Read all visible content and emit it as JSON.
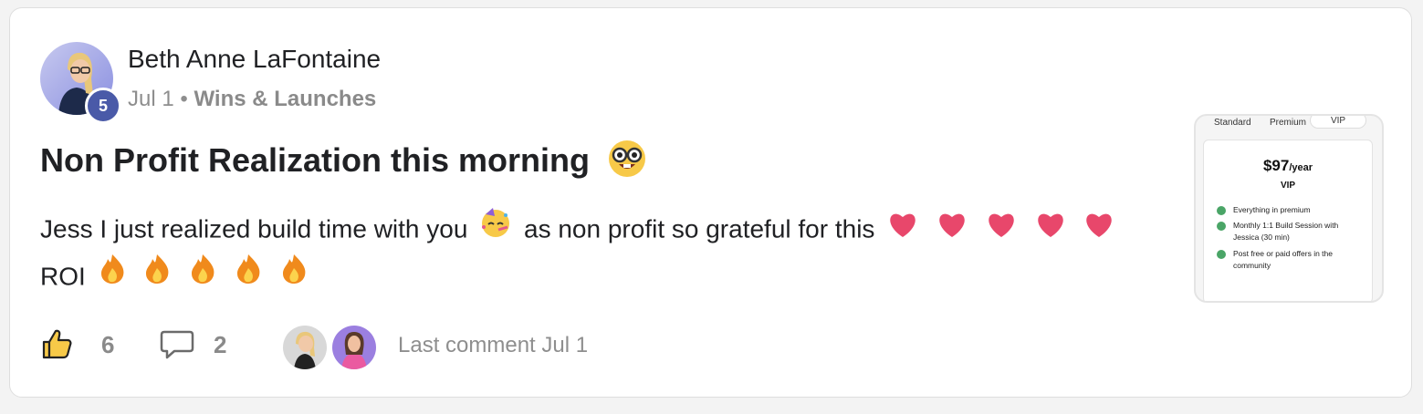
{
  "post": {
    "author": "Beth Anne LaFontaine",
    "level": "5",
    "date": "Jul 1",
    "separator": "•",
    "category": "Wins & Launches",
    "title": "Non Profit Realization this morning",
    "body_part1": "Jess I just realized build time with you",
    "body_part2": "as non profit so grateful for this",
    "body_part3": "ROI",
    "likes": "6",
    "comments": "2",
    "last_comment": "Last comment Jul 1"
  },
  "thumbnail": {
    "tabs": [
      "Standard",
      "Premium",
      "VIP"
    ],
    "price": "$97",
    "period": "/year",
    "plan": "VIP",
    "features": [
      "Everything in premium",
      "Monthly 1:1 Build Session with Jessica (30 min)",
      "Post free or paid offers in the community"
    ]
  },
  "icons": {
    "title_emoji": "nerd-face-icon",
    "body_emoji": "partying-face-icon",
    "hearts": "heart-icon",
    "fires": "fire-icon",
    "like": "thumbs-up-icon",
    "comment": "speech-bubble-icon"
  },
  "colors": {
    "badge": "#4a5aa8",
    "heart": "#e8476b",
    "fire": "#f08a1c",
    "muted": "#8e8e8e"
  }
}
